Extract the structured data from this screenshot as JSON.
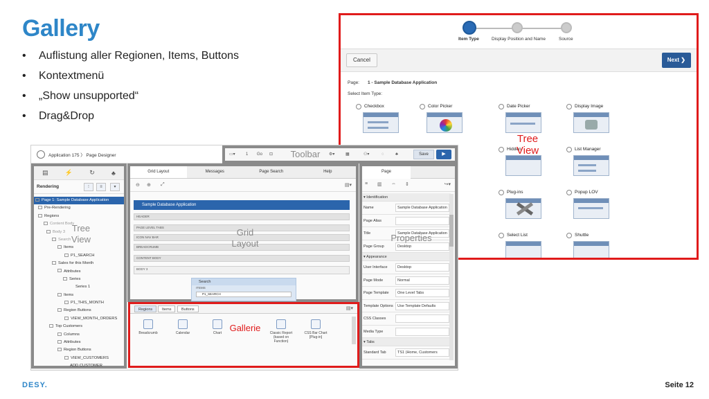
{
  "slide": {
    "title": "Gallery",
    "bullets": [
      "Auflistung aller Regionen, Items, Buttons",
      "Kontextmenü",
      "„Show unsupported“",
      "Drag&Drop"
    ],
    "logo": "DESY.",
    "page_label": "Seite",
    "page_number": "12"
  },
  "wizard": {
    "steps": [
      "Item Type",
      "Display Position and Name",
      "Source"
    ],
    "cancel_label": "Cancel",
    "next_label": "Next",
    "page_label": "Page:",
    "page_value": "1 - Sample Database Application",
    "select_label": "Select Item Type:",
    "items": [
      "Checkbox",
      "Color Picker",
      "Date Picker",
      "Display Image",
      "Hidden",
      "List Manager",
      "Plug-ins",
      "Popup LOV",
      "Select List",
      "Shuttle"
    ],
    "overlay": "Tree\nView"
  },
  "designer": {
    "app_crumb": "Application 175 〉 Page Designer",
    "tree": {
      "heading": "Rendering",
      "rows": [
        "Page 1: Sample Database Application",
        "Pre-Rendering",
        "Regions",
        "Content Body",
        "Body 3",
        "Search",
        "Items",
        "P1_SEARCH",
        "Sales for this Month",
        "Attributes",
        "Series",
        "Series 1",
        "Items",
        "P1_THIS_MONTH",
        "Region Buttons",
        "VIEW_MONTH_ORDERS",
        "Top Customers",
        "Columns",
        "Attributes",
        "Region Buttons",
        "VIEW_CUSTOMERS",
        "ADD CUSTOMER"
      ],
      "overlay": "Tree\nView"
    },
    "grid": {
      "tabs": [
        "Grid Layout",
        "Messages",
        "Page Search",
        "Help"
      ],
      "page_bar": "Sample Database Application",
      "regions": [
        "HEADER",
        "PAGE LEVEL TABS",
        "ICON NAV BAR",
        "BREADCRUMB",
        "CONTENT BODY",
        "BODY 3"
      ],
      "search_title": "Search",
      "search_sub": "ITEMS",
      "search_item": "P1_SEARCH",
      "overlay": "Grid\nLayout"
    },
    "gallery": {
      "tabs": [
        "Regions",
        "Items",
        "Buttons"
      ],
      "items": [
        "Breadcrumb",
        "Calendar",
        "Chart",
        "Classic Report (based on Function)",
        "CSS Bar Chart [Plug-in]"
      ],
      "overlay": "Gallerie"
    },
    "toolbar": {
      "page_number": "1",
      "go": "Go",
      "save": "Save",
      "overlay": "Toolbar"
    },
    "properties": {
      "tab": "Page",
      "rows": [
        {
          "group": "Identification"
        },
        {
          "k": "Name",
          "v": "Sample Database Application"
        },
        {
          "k": "Page Alias",
          "v": ""
        },
        {
          "k": "Title",
          "v": "Sample Database Application"
        },
        {
          "k": "Page Group",
          "v": "Desktop"
        },
        {
          "group": "Appearance"
        },
        {
          "k": "User Interface",
          "v": "Desktop"
        },
        {
          "k": "Page Mode",
          "v": "Normal"
        },
        {
          "k": "Page Template",
          "v": "One Level Tabs"
        },
        {
          "k": "Template Options",
          "v": "Use Template Defaults"
        },
        {
          "k": "CSS Classes",
          "v": ""
        },
        {
          "k": "Media Type",
          "v": ""
        },
        {
          "group": "Tabs"
        },
        {
          "k": "Standard Tab",
          "v": "TS1 (Home, Customers"
        }
      ],
      "overlay": "Properties"
    }
  },
  "colors": {
    "title": "#2e86c8",
    "highlight_red": "#e01b1b",
    "frame_gray": "#8a8a8a",
    "apex_blue": "#2b65ac"
  }
}
